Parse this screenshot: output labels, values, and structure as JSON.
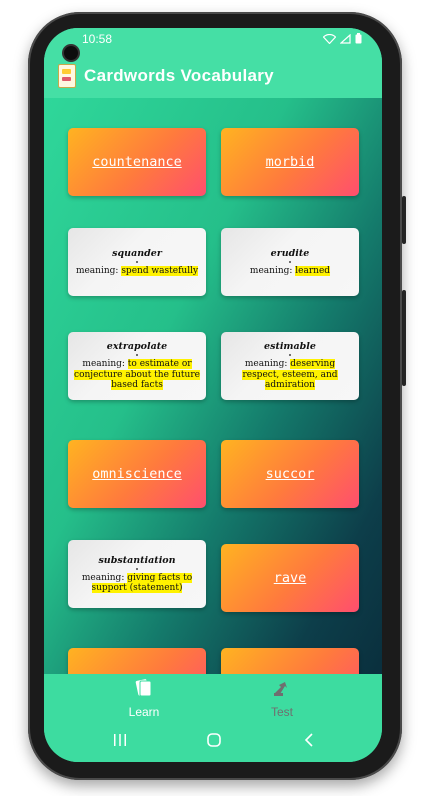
{
  "status_bar": {
    "time": "10:58"
  },
  "app_bar": {
    "title": "Cardwords Vocabulary",
    "logo_icon": "cards-logo-icon"
  },
  "cards": [
    {
      "type": "word",
      "word": "countenance"
    },
    {
      "type": "word",
      "word": "morbid"
    },
    {
      "type": "definition",
      "term": "squander",
      "meaning_label": "meaning:",
      "meaning": "spend wastefully"
    },
    {
      "type": "definition",
      "term": "erudite",
      "meaning_label": "meaning:",
      "meaning": "learned"
    },
    {
      "type": "definition",
      "term": "extrapolate",
      "meaning_label": "meaning:",
      "meaning": "to estimate or conjecture about the future based facts"
    },
    {
      "type": "definition",
      "term": "estimable",
      "meaning_label": "meaning:",
      "meaning": "deserving respect, esteem, and admiration"
    },
    {
      "type": "word",
      "word": "omniscience"
    },
    {
      "type": "word",
      "word": "succor"
    },
    {
      "type": "definition",
      "term": "substantiation",
      "meaning_label": "meaning:",
      "meaning": "giving facts to support (statement)"
    },
    {
      "type": "word",
      "word": "rave"
    },
    {
      "type": "word",
      "word": ""
    },
    {
      "type": "word",
      "word": ""
    }
  ],
  "bottom_nav": {
    "items": [
      {
        "label": "Learn",
        "icon": "cards-icon",
        "active": true
      },
      {
        "label": "Test",
        "icon": "test-hand-icon",
        "active": false
      }
    ]
  },
  "colors": {
    "accent": "#3ddca0",
    "card_gradient_start": "#ffb321",
    "card_gradient_end": "#ff4e6e",
    "highlight": "#fff200"
  }
}
